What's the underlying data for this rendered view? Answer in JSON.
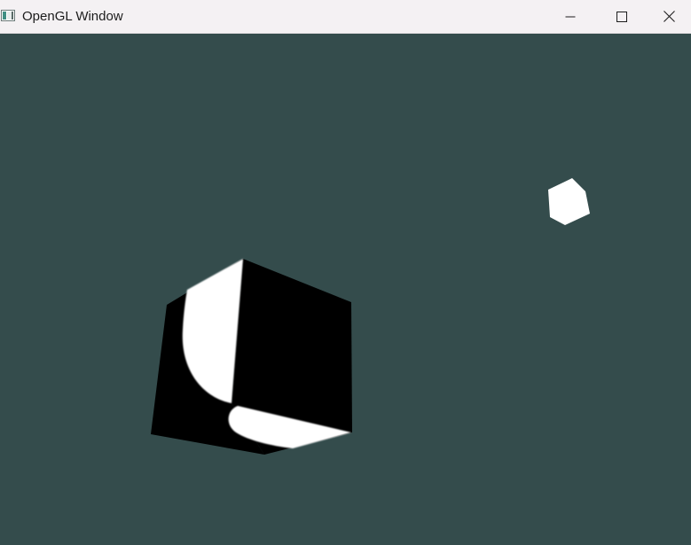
{
  "window": {
    "title": "OpenGL Window"
  },
  "controls": {
    "minimize_icon": "minimize-icon",
    "maximize_icon": "maximize-icon",
    "close_icon": "close-icon"
  },
  "scene": {
    "clear_color": "#344c4c",
    "object_color": "#000000",
    "highlight_color": "#ffffff",
    "light_source_color": "#ffffff"
  }
}
